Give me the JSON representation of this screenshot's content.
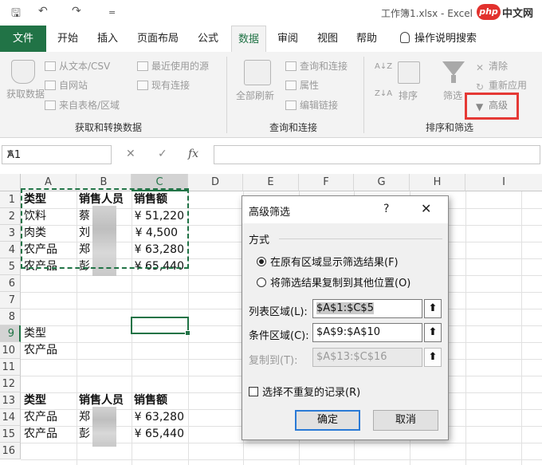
{
  "titlebar": {
    "qa_save": "🖫",
    "qa_undo": "↶",
    "qa_redo": "↷",
    "qa_customize": "=",
    "workbook_title": "工作簿1.xlsx  -  Excel",
    "watermark": "php中文网"
  },
  "tabs": [
    "文件",
    "开始",
    "插入",
    "页面布局",
    "公式",
    "数据",
    "审阅",
    "视图",
    "帮助"
  ],
  "active_tab": "数据",
  "tell_me": "操作说明搜索",
  "ribbon": {
    "get_data": "获取数据",
    "from_text_csv": "从文本/CSV",
    "from_web": "自网站",
    "from_table": "来自表格/区域",
    "recent_sources": "最近使用的源",
    "existing_connections": "现有连接",
    "group_get_transform": "获取和转换数据",
    "refresh_all": "全部刷新",
    "queries_connections": "查询和连接",
    "properties": "属性",
    "edit_links": "编辑链接",
    "group_queries": "查询和连接",
    "sort_az": "A↓Z",
    "sort_za": "Z↓A",
    "sort": "排序",
    "filter": "筛选",
    "clear": "清除",
    "reapply": "重新应用",
    "advanced": "高级",
    "group_sort_filter": "排序和筛选"
  },
  "formula_bar": {
    "name_box": "A1",
    "cancel": "✕",
    "enter": "✓",
    "fx": "fx",
    "formula": ""
  },
  "columns": [
    "A",
    "B",
    "C",
    "D",
    "E",
    "F",
    "G",
    "H",
    "I"
  ],
  "rows": [
    "1",
    "2",
    "3",
    "4",
    "5",
    "6",
    "7",
    "8",
    "9",
    "10",
    "11",
    "12",
    "13",
    "14",
    "15",
    "16"
  ],
  "cells": {
    "a1": "类型",
    "b1": "销售人员",
    "c1": "销售额",
    "a2": "饮料",
    "b2": "蔡",
    "c2": "¥ 51,220",
    "a3": "肉类",
    "b3": "刘",
    "c3": "¥ 4,500",
    "a4": "农产品",
    "b4": "郑",
    "c4": "¥ 63,280",
    "a5": "农产品",
    "b5": "彭",
    "c5": "¥ 65,440",
    "a9": "类型",
    "a10": "农产品",
    "a13": "类型",
    "b13": "销售人员",
    "c13": "销售额",
    "a14": "农产品",
    "b14": "郑",
    "c14": "¥ 63,280",
    "a15": "农产品",
    "b15": "彭",
    "c15": "¥ 65,440"
  },
  "dialog": {
    "title": "高级筛选",
    "help": "?",
    "close": "✕",
    "section": "方式",
    "radio_in_place": "在原有区域显示筛选结果(F)",
    "radio_copy": "将筛选结果复制到其他位置(O)",
    "list_range_label": "列表区域(L):",
    "list_range_value": "$A$1:$C$5",
    "criteria_range_label": "条件区域(C):",
    "criteria_range_value": "$A$9:$A$10",
    "copy_to_label": "复制到(T):",
    "copy_to_value": "$A$13:$C$16",
    "unique_records": "选择不重复的记录(R)",
    "ok": "确定",
    "cancel": "取消"
  }
}
